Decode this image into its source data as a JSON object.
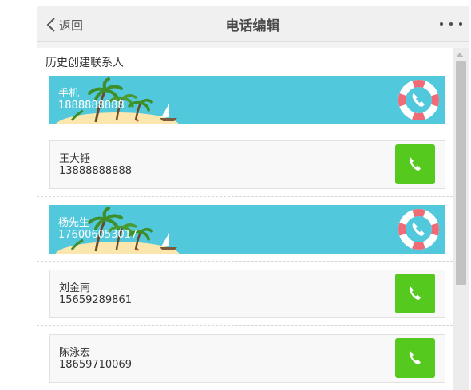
{
  "header": {
    "back_label": "返回",
    "title": "电话编辑"
  },
  "section": {
    "title": "历史创建联系人"
  },
  "contacts": [
    {
      "name": "手机",
      "phone": "1888888888",
      "style": "banner",
      "action_icon": "lifebuoy-icon"
    },
    {
      "name": "王大锤",
      "phone": "13888888888",
      "style": "card",
      "action_icon": "phone-icon"
    },
    {
      "name": "杨先生",
      "phone": "17600605301​7",
      "style": "banner",
      "action_icon": "lifebuoy-icon"
    },
    {
      "name": "刘金南",
      "phone": "15659289861",
      "style": "card",
      "action_icon": "phone-icon"
    },
    {
      "name": "陈泳宏",
      "phone": "18659710069",
      "style": "card",
      "action_icon": "phone-icon"
    }
  ],
  "colors": {
    "banner": "#52c8dc",
    "call_button": "#56c91f",
    "lifebuoy_red": "#f06b78",
    "header_bg": "#f0f0f0"
  }
}
